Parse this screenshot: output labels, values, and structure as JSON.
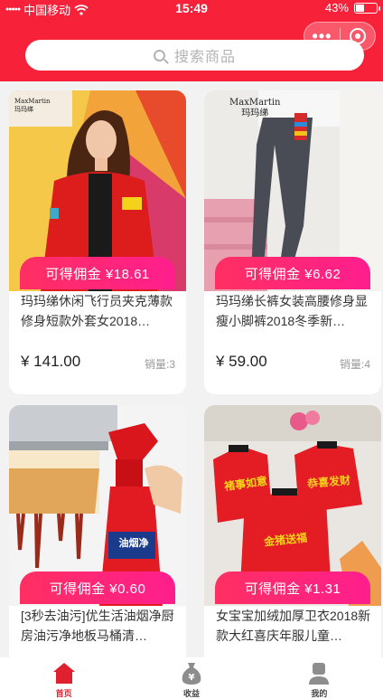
{
  "status_bar": {
    "carrier": "中国移动",
    "time": "15:49",
    "battery": "43%",
    "battery_level": 0.43
  },
  "header": {
    "search_placeholder": "搜索商品",
    "capsule_more": "•••",
    "accent_color": "#f7213a"
  },
  "products": [
    {
      "brand": "MaxMartin",
      "brand_cn": "玛玛绨",
      "commission": "可得佣金 ¥18.61",
      "title": "玛玛绨休闲飞行员夹克薄款修身短款外套女2018…",
      "price": "¥ 141.00",
      "sales": "销量:3"
    },
    {
      "brand": "MaxMartin",
      "brand_cn": "玛玛绨",
      "commission": "可得佣金 ¥6.62",
      "title": "玛玛绨长裤女装高腰修身显瘦小脚裤2018冬季新…",
      "price": "¥ 59.00",
      "sales": "销量:4"
    },
    {
      "bottle_label": "油烟净",
      "commission": "可得佣金 ¥0.60",
      "title": "[3秒去油污]优生活油烟净厨房油污净地板马桶清…",
      "price": "",
      "sales": ""
    },
    {
      "print_1": "褚事如意",
      "print_2": "恭喜发财",
      "print_3": "金猪送福",
      "commission": "可得佣金 ¥1.31",
      "title": "女宝宝加绒加厚卫衣2018新款大红喜庆年服儿童…",
      "price": "",
      "sales": ""
    }
  ],
  "tabbar": {
    "items": [
      {
        "label": "首页",
        "icon": "home-icon",
        "active": true
      },
      {
        "label": "收益",
        "icon": "money-bag-icon",
        "active": false
      },
      {
        "label": "我的",
        "icon": "person-icon",
        "active": false
      }
    ],
    "active_color": "#e0202f"
  }
}
